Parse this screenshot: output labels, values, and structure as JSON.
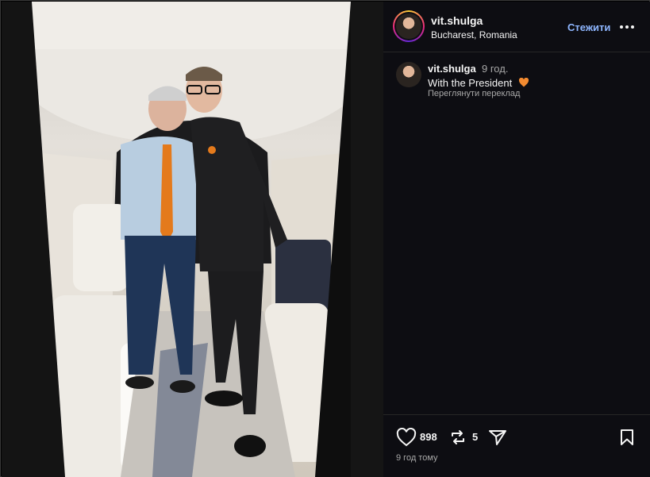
{
  "post": {
    "username": "vit.shulga",
    "location": "Bucharest, Romania",
    "follow_label": "Стежити"
  },
  "caption": {
    "username": "vit.shulga",
    "time": "9 год.",
    "text": "With the President",
    "translation_label": "Переглянути переклад"
  },
  "actions": {
    "likes": "898",
    "reposts": "5",
    "posted_ago": "9 год тому"
  },
  "icons": {
    "more": "more-horizontal-icon",
    "heart": "heart-icon",
    "repost": "repost-icon",
    "share": "share-icon",
    "save": "bookmark-icon",
    "caption_emoji": "orange-heart-icon"
  },
  "colors": {
    "panel_bg": "#0d0d12",
    "follow": "#8eb6ff",
    "accent_heart": "#f28a30"
  }
}
